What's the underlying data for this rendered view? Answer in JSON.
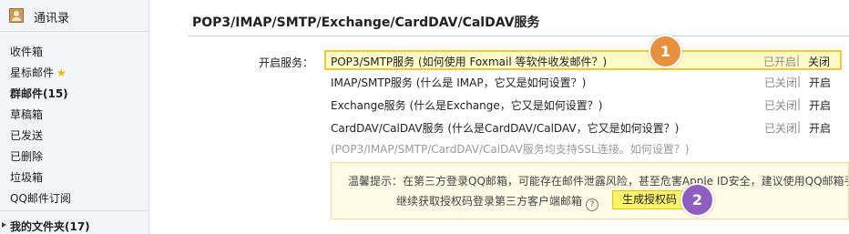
{
  "sidebar": {
    "contacts_label": "通讯录",
    "items": [
      {
        "label": "收件箱"
      },
      {
        "label": "星标邮件"
      },
      {
        "label": "群邮件(15)"
      },
      {
        "label": "草稿箱"
      },
      {
        "label": "已发送"
      },
      {
        "label": "已删除"
      },
      {
        "label": "垃圾箱"
      },
      {
        "label": "QQ邮件订阅"
      }
    ],
    "folders_label": "我的文件夹(17)"
  },
  "main": {
    "section_title": "POP3/IMAP/SMTP/Exchange/CardDAV/CalDAV服务",
    "open_service_label": "开启服务：",
    "services": [
      {
        "text": "POP3/SMTP服务 (如何使用 Foxmail 等软件收发邮件？)",
        "status": "已开启",
        "separator": "|",
        "action": "关闭"
      },
      {
        "text": "IMAP/SMTP服务 (什么是 IMAP，它又是如何设置？)",
        "status": "已关闭",
        "separator": "|",
        "action": "开启"
      },
      {
        "text": "Exchange服务 (什么是Exchange，它又是如何设置？)",
        "status": "已关闭",
        "separator": "|",
        "action": "开启"
      },
      {
        "text": "CardDAV/CalDAV服务 (什么是CardDAV/CalDAV，它又是如何设置？)",
        "status": "已关闭",
        "separator": "|",
        "action": "开启"
      }
    ],
    "ssl_note": "(POP3/IMAP/SMTP/CardDAV/CalDAV服务均支持SSL连接。如何设置？)",
    "tip": {
      "line1": "温馨提示：在第三方登录QQ邮箱，可能存在邮件泄露风险，甚至危害Apple ID安全，建议使用QQ邮箱手",
      "line2": "继续获取授权码登录第三方客户端邮箱",
      "help_glyph": "?",
      "button_label": "生成授权码"
    }
  },
  "badges": {
    "one": "1",
    "two": "2"
  },
  "colors": {
    "highlight_bg": "#fffbc8",
    "highlight_border": "#f0c93a",
    "badge_orange": "#e7913e",
    "badge_purple": "#8e5fc0",
    "button_yellow": "#fff46b"
  }
}
